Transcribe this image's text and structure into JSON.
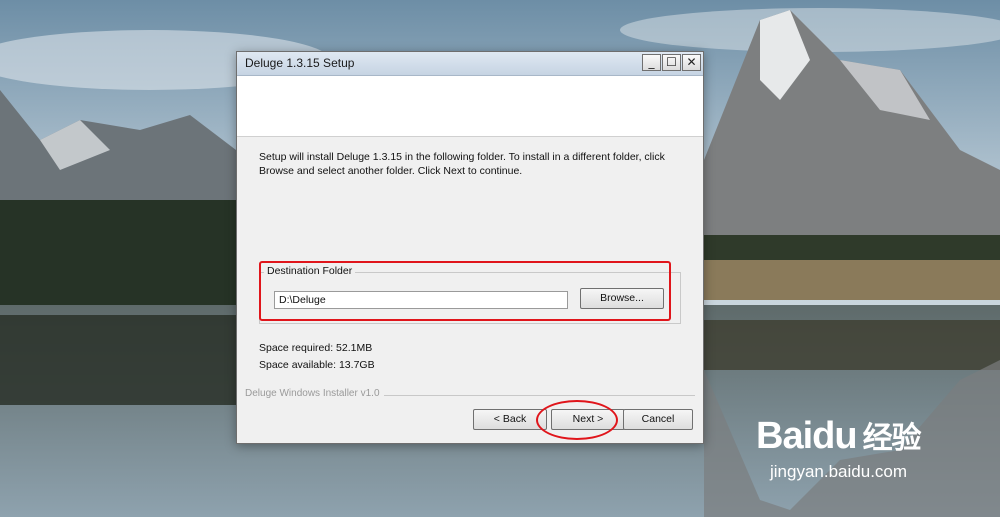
{
  "dialog": {
    "title": "Deluge 1.3.15 Setup",
    "intro_text": "Setup will install Deluge 1.3.15 in the following folder. To install in a different folder, click Browse and select another folder. Click Next to continue.",
    "destination_folder_label": "Destination Folder",
    "destination_path": "D:\\Deluge",
    "browse_label": "Browse...",
    "space_required": "Space required: 52.1MB",
    "space_available": "Space available: 13.7GB",
    "installer_brand": "Deluge Windows Installer v1.0",
    "back_label": "< Back",
    "next_label": "Next >",
    "cancel_label": "Cancel",
    "minimize_glyph": "_",
    "maximize_glyph": "☐",
    "close_glyph": "✕"
  },
  "watermark": {
    "brand": "Baidu",
    "brand_cn": "经验",
    "url": "jingyan.baidu.com"
  },
  "colors": {
    "highlight": "#e0151b",
    "dialog_bg": "#f0f0f0"
  }
}
